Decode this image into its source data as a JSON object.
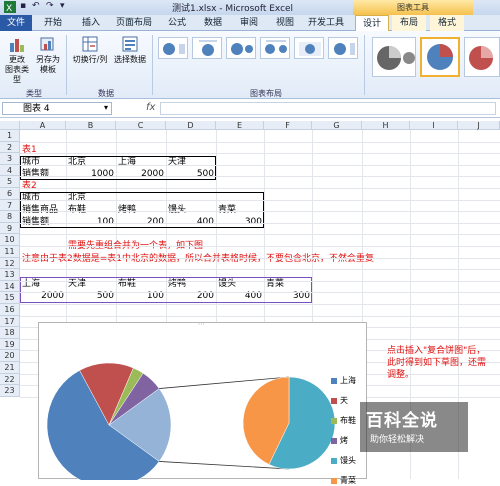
{
  "window": {
    "title": "测试1.xlsx - Microsoft Excel",
    "chart_tools": "图表工具"
  },
  "tabs": [
    "文件",
    "开始",
    "插入",
    "页面布局",
    "公式",
    "数据",
    "审阅",
    "视图",
    "开发工具",
    "设计",
    "布局",
    "格式"
  ],
  "ribbon": {
    "change_type": "更改",
    "change_type2": "图表类型",
    "save_template": "另存为",
    "save_template2": "模板",
    "switch_rowcol": "切换行/列",
    "select_data": "选择数据",
    "group_type": "类型",
    "group_data": "数据",
    "group_layout": "图表布局"
  },
  "formula": {
    "namebox": "图表 4",
    "fx": "fx"
  },
  "columns": [
    "A",
    "B",
    "C",
    "D",
    "E",
    "F",
    "G",
    "H",
    "I",
    "J"
  ],
  "rows": [
    "1",
    "2",
    "3",
    "4",
    "5",
    "6",
    "7",
    "8",
    "9",
    "10",
    "11",
    "12",
    "13",
    "14",
    "15",
    "16",
    "17",
    "18",
    "19",
    "20",
    "21",
    "22",
    "23"
  ],
  "sheet": {
    "t1_title": "表1",
    "t1_city": "城市",
    "t1_bj": "北京",
    "t1_sh": "上海",
    "t1_tj": "天津",
    "t1_sales": "销售额",
    "t1_v1": "1000",
    "t1_v2": "2000",
    "t1_v3": "500",
    "t2_title": "表2",
    "t2_city": "城市",
    "t2_bj": "北京",
    "t2_item": "销售商品",
    "t2_a": "布鞋",
    "t2_b": "烤鸭",
    "t2_c": "馒头",
    "t2_d": "青菜",
    "t2_sales": "销售额",
    "t2_v1": "100",
    "t2_v2": "200",
    "t2_v3": "400",
    "t2_v4": "300",
    "note1": "需要先重组合并为一个表，如下图",
    "note2": "注意由于表2数据是=表1中北京的数据，所以合并表格时候，不要包含北京，不然会重复",
    "m_h1": "上海",
    "m_h2": "天津",
    "m_h3": "布鞋",
    "m_h4": "烤鸭",
    "m_h5": "馒头",
    "m_h6": "青菜",
    "m_v1": "2000",
    "m_v2": "500",
    "m_v3": "100",
    "m_v4": "200",
    "m_v5": "400",
    "m_v6": "300"
  },
  "chart_data": {
    "type": "pie",
    "categories": [
      "上海",
      "天津",
      "布鞋",
      "烤鸭",
      "馒头",
      "青菜"
    ],
    "values": [
      2000,
      500,
      100,
      200,
      400,
      300
    ],
    "colors": [
      "#4f81bd",
      "#c0504d",
      "#9bbb59",
      "#8064a2",
      "#4bacc6",
      "#f79646"
    ],
    "legend_placement": "right"
  },
  "legend": [
    "上海",
    "天",
    "布鞋",
    "烤",
    "馒头",
    "青菜"
  ],
  "annotation": "点击插入\"复合饼图\"后，此时得到如下草图，还需调整。",
  "watermark": {
    "big": "百科全说",
    "small": "助你轻松解决"
  }
}
